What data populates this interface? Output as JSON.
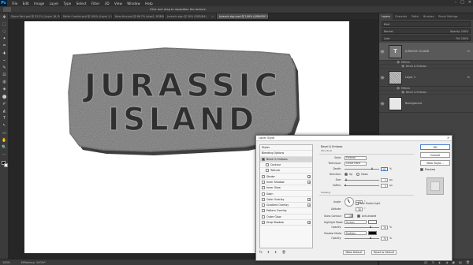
{
  "app": {
    "logo": "Ps"
  },
  "menu": [
    "File",
    "Edit",
    "Image",
    "Layer",
    "Type",
    "Select",
    "Filter",
    "3D",
    "View",
    "Window",
    "Help"
  ],
  "window_buttons": [
    "–",
    "□",
    "✕"
  ],
  "options_bar": {
    "hint": "Click and drag to reposition the texture."
  },
  "tabs": [
    {
      "label": "Stone Park.psd @ 33.3% (Layer 16, RGB/8#)",
      "active": false
    },
    {
      "label": "Roller Coaster.psd @ 100% (Layer 1, RGB/8#)",
      "active": false
    },
    {
      "label": "New dino.psd @ 66.7% (step2, RGB/8#)",
      "active": false
    },
    {
      "label": "Jurassic sign @ 50% (RGB/8#)",
      "active": false
    },
    {
      "label": "Jurassic sign.psd @ 100% (JURASSIC ISLAND, RGB/8#)",
      "active": true
    }
  ],
  "tools": [
    "✥",
    "⬚",
    "◌",
    "✦",
    "⌗",
    "✚",
    "⌁",
    "✎",
    "⊡",
    "◍",
    "◈",
    "⬤",
    "✐",
    "◭",
    "T",
    "↖",
    "▭",
    "✋",
    "🔍",
    "···"
  ],
  "canvas": {
    "line1": "JURASSIC",
    "line2": "ISLAND",
    "colors": {
      "stone": "#6e6e6e",
      "stone_dark": "#3e3e3e",
      "stone_light": "#9a9a9a",
      "letter": "#2f2f2f"
    }
  },
  "status": {
    "zoom": "100%",
    "doc": "Efficiency: 100%*"
  },
  "panels": {
    "tabs": [
      "Layers",
      "Channels",
      "Paths",
      "Brushes",
      "Brush Settings"
    ],
    "kind_label": "Kind",
    "blend_mode": "Normal",
    "opacity_label": "Opacity: 100%",
    "lock_label": "Lock:",
    "fill_label": "Fill: 100%",
    "layers": [
      {
        "name": "JURASSIC ISLAND",
        "thumb": "T",
        "type": "text",
        "selected": true,
        "fx": "fx",
        "effects_label": "Effects",
        "effects": [
          "Bevel & Emboss"
        ]
      },
      {
        "name": "Layer 1",
        "thumb": "",
        "type": "pattern",
        "selected": false,
        "fx": "fx",
        "effects_label": "Effects",
        "effects": [
          "Bevel & Emboss"
        ]
      },
      {
        "name": "Background",
        "thumb": "",
        "type": "white",
        "selected": false,
        "fx": "",
        "effects_label": "",
        "effects": []
      }
    ],
    "bottom_icons": [
      "⛓",
      "fx",
      "◐",
      "◑",
      "▣",
      "▤",
      "🗑"
    ]
  },
  "dialog": {
    "title": "Layer Style",
    "close": "✕",
    "styles": [
      {
        "label": "Styles",
        "check": false,
        "checked": false,
        "plus": false,
        "indent": false,
        "selected": false
      },
      {
        "label": "Blending Options",
        "check": false,
        "checked": false,
        "plus": false,
        "indent": false,
        "selected": false
      },
      {
        "label": "Bevel & Emboss",
        "check": true,
        "checked": true,
        "plus": false,
        "indent": false,
        "selected": true
      },
      {
        "label": "Contour",
        "check": true,
        "checked": false,
        "plus": false,
        "indent": true,
        "selected": false
      },
      {
        "label": "Texture",
        "check": true,
        "checked": false,
        "plus": false,
        "indent": true,
        "selected": false
      },
      {
        "label": "Stroke",
        "check": true,
        "checked": false,
        "plus": true,
        "indent": false,
        "selected": false
      },
      {
        "label": "Inner Shadow",
        "check": true,
        "checked": false,
        "plus": true,
        "indent": false,
        "selected": false
      },
      {
        "label": "Inner Glow",
        "check": true,
        "checked": false,
        "plus": false,
        "indent": false,
        "selected": false
      },
      {
        "label": "Satin",
        "check": true,
        "checked": false,
        "plus": false,
        "indent": false,
        "selected": false
      },
      {
        "label": "Color Overlay",
        "check": true,
        "checked": false,
        "plus": true,
        "indent": false,
        "selected": false
      },
      {
        "label": "Gradient Overlay",
        "check": true,
        "checked": false,
        "plus": true,
        "indent": false,
        "selected": false
      },
      {
        "label": "Pattern Overlay",
        "check": true,
        "checked": false,
        "plus": false,
        "indent": false,
        "selected": false
      },
      {
        "label": "Outer Glow",
        "check": true,
        "checked": false,
        "plus": false,
        "indent": false,
        "selected": false
      },
      {
        "label": "Drop Shadow",
        "check": true,
        "checked": false,
        "plus": true,
        "indent": false,
        "selected": false
      }
    ],
    "list_footer": [
      "fx",
      "⬆",
      "⬇",
      "🗑"
    ],
    "section_title": "Bevel & Emboss",
    "structure_label": "Structure",
    "style_label": "Style:",
    "style_value": "Emboss",
    "technique_label": "Technique:",
    "technique_value": "Chisel Hard",
    "depth_label": "Depth:",
    "depth_value": "81",
    "depth_level": 0.81,
    "direction_label": "Direction:",
    "direction_up": "Up",
    "direction_down": "Down",
    "size_label": "Size:",
    "size_value": "2",
    "size_level": 0.02,
    "soften_label": "Soften:",
    "soften_value": "0",
    "soften_level": 0.0,
    "unit_percent": "%",
    "unit_px": "px",
    "unit_deg": "°",
    "shading_label": "Shading",
    "angle_label": "Angle:",
    "angle_value": "90",
    "global_light": "Use Global Light",
    "altitude_label": "Altitude:",
    "altitude_value": "30",
    "gloss_label": "Gloss Contour:",
    "antialiased": "Anti-aliased",
    "highlight_label": "Highlight Mode:",
    "highlight_value": "Screen",
    "highlight_color": "#ffffff",
    "opacity_label": "Opacity:",
    "highlight_opacity": "75",
    "shadow_label": "Shadow Mode:",
    "shadow_value": "Multiply",
    "shadow_color": "#000000",
    "shadow_opacity": "75",
    "make_default": "Make Default",
    "reset_default": "Reset to Default",
    "ok": "OK",
    "cancel": "Cancel",
    "new_style": "New Style...",
    "preview": "Preview"
  }
}
